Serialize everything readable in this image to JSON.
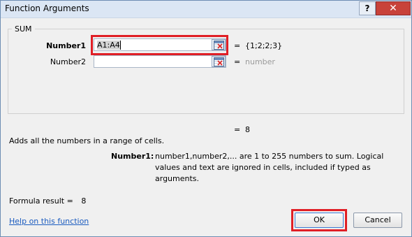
{
  "window": {
    "title": "Function Arguments",
    "help_label": "?",
    "close_label": "✕"
  },
  "function_box": {
    "title": "SUM",
    "args": [
      {
        "label": "Number1",
        "value": "A1:A4",
        "placeholder": "",
        "result": "{1;2;2;3}"
      },
      {
        "label": "Number2",
        "value": "",
        "placeholder": "",
        "result": "number"
      }
    ]
  },
  "overall_result_line": "8",
  "equals": "=",
  "description": "Adds all the numbers in a range of cells.",
  "arg_help": {
    "label": "Number1:",
    "text": "number1,number2,... are 1 to 255 numbers to sum. Logical values and text are ignored in cells, included if typed as arguments."
  },
  "formula_result": {
    "label": "Formula result =",
    "value": "8"
  },
  "footer": {
    "help_link": "Help on this function",
    "ok_label": "OK",
    "cancel_label": "Cancel"
  },
  "colors": {
    "highlight": "#e01f26",
    "link": "#1a5bbf"
  },
  "icons": {
    "range_picker": "collapse-dialog-icon"
  }
}
